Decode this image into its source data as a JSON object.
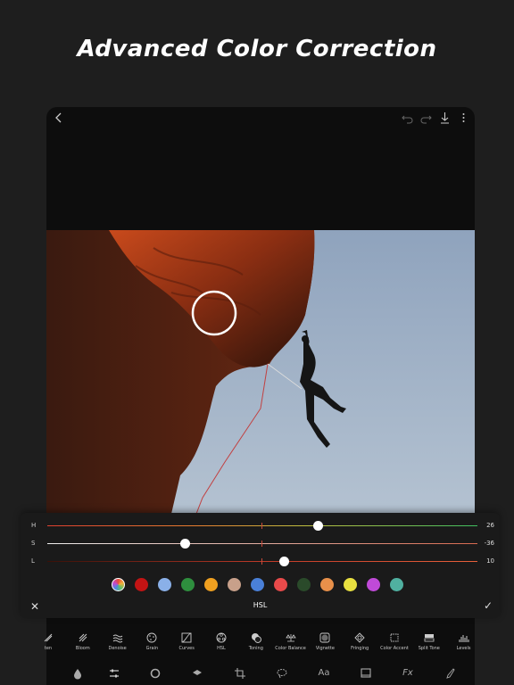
{
  "headline": "Advanced Color Correction",
  "topbar": {
    "icons": [
      "back-icon",
      "undo-icon",
      "redo-icon",
      "download-icon",
      "more-icon"
    ]
  },
  "hsl": {
    "title": "HSL",
    "sliders": [
      {
        "label": "H",
        "value": "26",
        "fraction": 0.63
      },
      {
        "label": "S",
        "value": "-36",
        "fraction": 0.32
      },
      {
        "label": "L",
        "value": "10",
        "fraction": 0.55
      }
    ],
    "swatches": [
      "#c21414",
      "#8ab0e8",
      "#2e8f3e",
      "#f0a020",
      "#c8a08a",
      "#4a80d8",
      "#e84a4a",
      "#2a4a2a",
      "#e8904a",
      "#e8e040",
      "#c04ad8",
      "#50b0a0"
    ],
    "picker_icon": "eyedropper-icon"
  },
  "tools": [
    {
      "label": "ten",
      "icon": "sharpen-icon"
    },
    {
      "label": "Bloom",
      "icon": "bloom-icon"
    },
    {
      "label": "Denoise",
      "icon": "denoise-icon"
    },
    {
      "label": "Grain",
      "icon": "grain-icon"
    },
    {
      "label": "Curves",
      "icon": "curves-icon"
    },
    {
      "label": "HSL",
      "icon": "hsl-icon"
    },
    {
      "label": "Toning",
      "icon": "toning-icon"
    },
    {
      "label": "Color Balance",
      "icon": "color-balance-icon"
    },
    {
      "label": "Vignette",
      "icon": "vignette-icon"
    },
    {
      "label": "Fringing",
      "icon": "fringing-icon"
    },
    {
      "label": "Color Accent",
      "icon": "color-accent-icon"
    },
    {
      "label": "Split Tone",
      "icon": "split-tone-icon"
    },
    {
      "label": "Levels",
      "icon": "levels-icon"
    }
  ],
  "bottombar": [
    {
      "icon": "drop-icon",
      "text": ""
    },
    {
      "icon": "adjust-icon",
      "text": ""
    },
    {
      "icon": "circle-icon",
      "text": ""
    },
    {
      "icon": "layers-icon",
      "text": ""
    },
    {
      "icon": "crop-icon",
      "text": ""
    },
    {
      "icon": "lasso-icon",
      "text": ""
    },
    {
      "icon": "text-icon",
      "text": "Aa"
    },
    {
      "icon": "frame-icon",
      "text": ""
    },
    {
      "icon": "fx-icon",
      "text": "Fx"
    },
    {
      "icon": "brush-icon",
      "text": ""
    }
  ]
}
